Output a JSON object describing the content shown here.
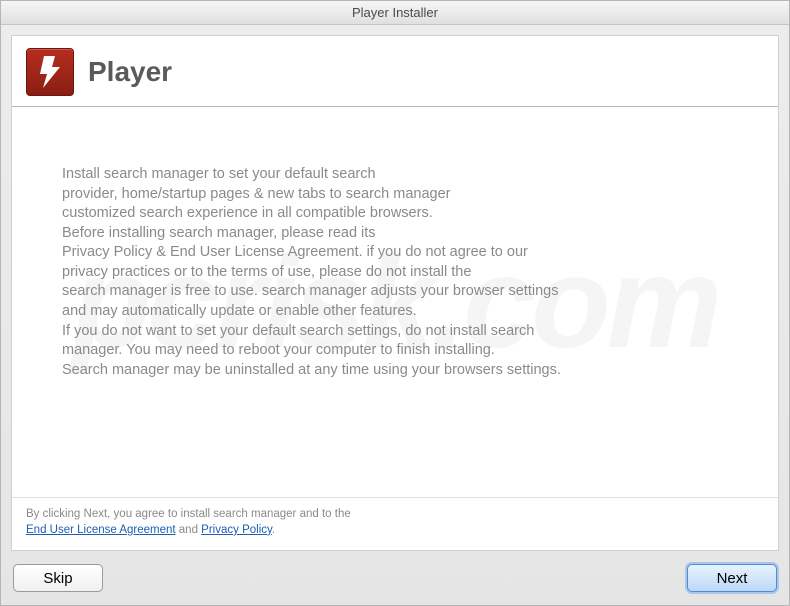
{
  "window": {
    "title": "Player Installer"
  },
  "header": {
    "title": "Player",
    "icon_name": "flash-player-icon"
  },
  "body": {
    "text": "Install search manager to set your default search\nprovider, home/startup pages & new tabs to search manager\ncustomized search experience in all compatible browsers.\nBefore installing search manager, please read its\nPrivacy Policy & End User License Agreement. if you do not agree to our\nprivacy practices or to the terms of use, please do not install the\nsearch manager is free to use. search manager adjusts your browser settings\nand may automatically update or enable other features.\nIf you do not want to set your default search settings, do not install search\nmanager. You may need to reboot your computer to finish installing.\nSearch manager may be uninstalled at any time using your browsers settings."
  },
  "footer": {
    "line1": "By clicking Next, you agree to install search manager and to the",
    "eula_link": "End User License Agreement",
    "and": " and ",
    "privacy_link": "Privacy Policy",
    "period": "."
  },
  "buttons": {
    "skip": "Skip",
    "next": "Next"
  },
  "watermark": "pcrisk.com"
}
